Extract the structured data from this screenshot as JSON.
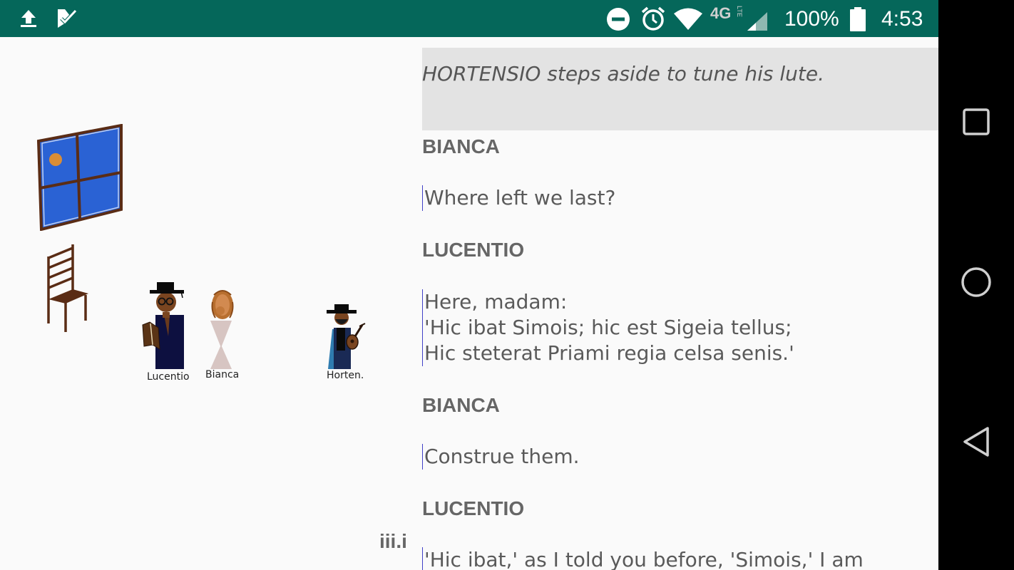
{
  "status_bar": {
    "battery": "100%",
    "time": "4:53",
    "network": "4G",
    "network_sub": "LTE",
    "left_icons": [
      "upload-icon",
      "task-check-icon"
    ],
    "right_icons": [
      "do-not-disturb-icon",
      "alarm-icon",
      "wifi-icon",
      "cell-signal-icon",
      "battery-icon"
    ]
  },
  "stage": {
    "characters": [
      {
        "label": "Lucentio"
      },
      {
        "label": "Bianca"
      },
      {
        "label": "Horten."
      }
    ],
    "props": [
      "window",
      "chair"
    ],
    "scene": "iii.i"
  },
  "script": {
    "stage_direction": "HORTENSIO steps aside to tune his lute.",
    "blocks": [
      {
        "speaker": "BIANCA",
        "text": "Where left we last?"
      },
      {
        "speaker": "LUCENTIO",
        "text": "Here, madam:\n'Hic ibat Simois; hic est Sigeia tellus;\nHic steterat Priami regia celsa senis.'"
      },
      {
        "speaker": "BIANCA",
        "text": "Construe them."
      },
      {
        "speaker": "LUCENTIO",
        "text": "'Hic ibat,' as I told you before, 'Simois,' I am"
      }
    ]
  },
  "navigation": {
    "buttons": [
      "recents-button",
      "home-button",
      "back-button"
    ]
  },
  "colors": {
    "status_bar": "#05675a",
    "background": "#fafafa",
    "stage_direction_bg": "#e3e3e3",
    "line_marker": "#4040c8"
  }
}
